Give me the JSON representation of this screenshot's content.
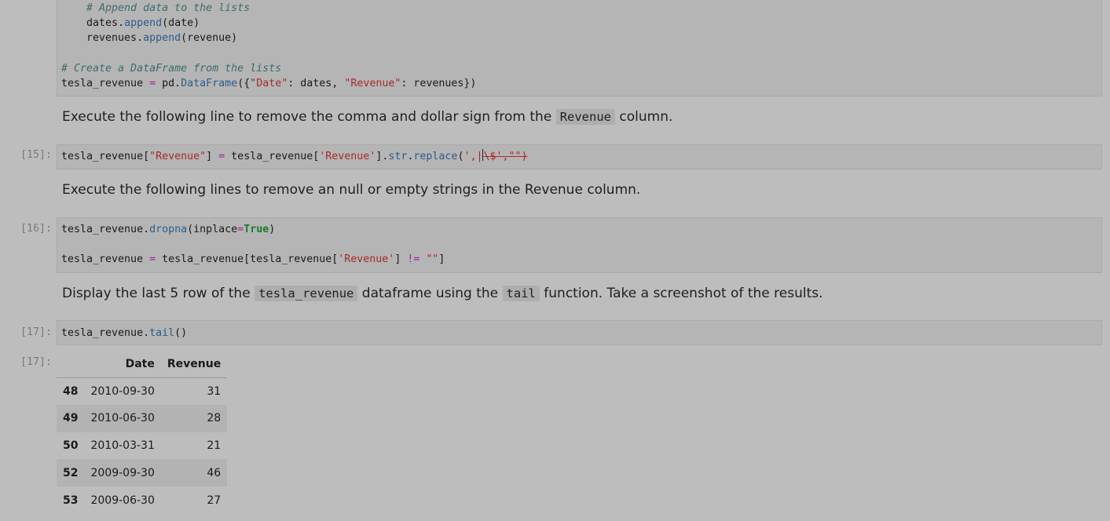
{
  "cell_top": {
    "lines": [
      "    # Append data to the lists",
      "    dates.append(date)",
      "    revenues.append(revenue)",
      "",
      "# Create a DataFrame from the lists",
      "tesla_revenue = pd.DataFrame({\"Date\": dates, \"Revenue\": revenues})"
    ]
  },
  "md1": {
    "before": "Execute the following line to remove the comma and dollar sign from the ",
    "code": "Revenue",
    "after": " column."
  },
  "cell15": {
    "prompt": "[15]:",
    "code": "tesla_revenue[\"Revenue\"] = tesla_revenue['Revenue'].str.replace(',|\\$',\"\")"
  },
  "md2": {
    "text": "Execute the following lines to remove an null or empty strings in the Revenue column."
  },
  "cell16": {
    "prompt": "[16]:",
    "line1": "tesla_revenue.dropna(inplace=True)",
    "line2": "tesla_revenue = tesla_revenue[tesla_revenue['Revenue'] != \"\"]"
  },
  "md3": {
    "p1": "Display the last 5 row of the ",
    "code1": "tesla_revenue",
    "p2": " dataframe using the ",
    "code2": "tail",
    "p3": " function. Take a screenshot of the results."
  },
  "cell17": {
    "prompt": "[17]:",
    "code": "tesla_revenue.tail()"
  },
  "out17": {
    "prompt": "[17]:",
    "columns": [
      "",
      "Date",
      "Revenue"
    ],
    "rows": [
      {
        "index": "48",
        "date": "2010-09-30",
        "revenue": "31"
      },
      {
        "index": "49",
        "date": "2010-06-30",
        "revenue": "28"
      },
      {
        "index": "50",
        "date": "2010-03-31",
        "revenue": "21"
      },
      {
        "index": "52",
        "date": "2009-09-30",
        "revenue": "46"
      },
      {
        "index": "53",
        "date": "2009-06-30",
        "revenue": "27"
      }
    ]
  }
}
